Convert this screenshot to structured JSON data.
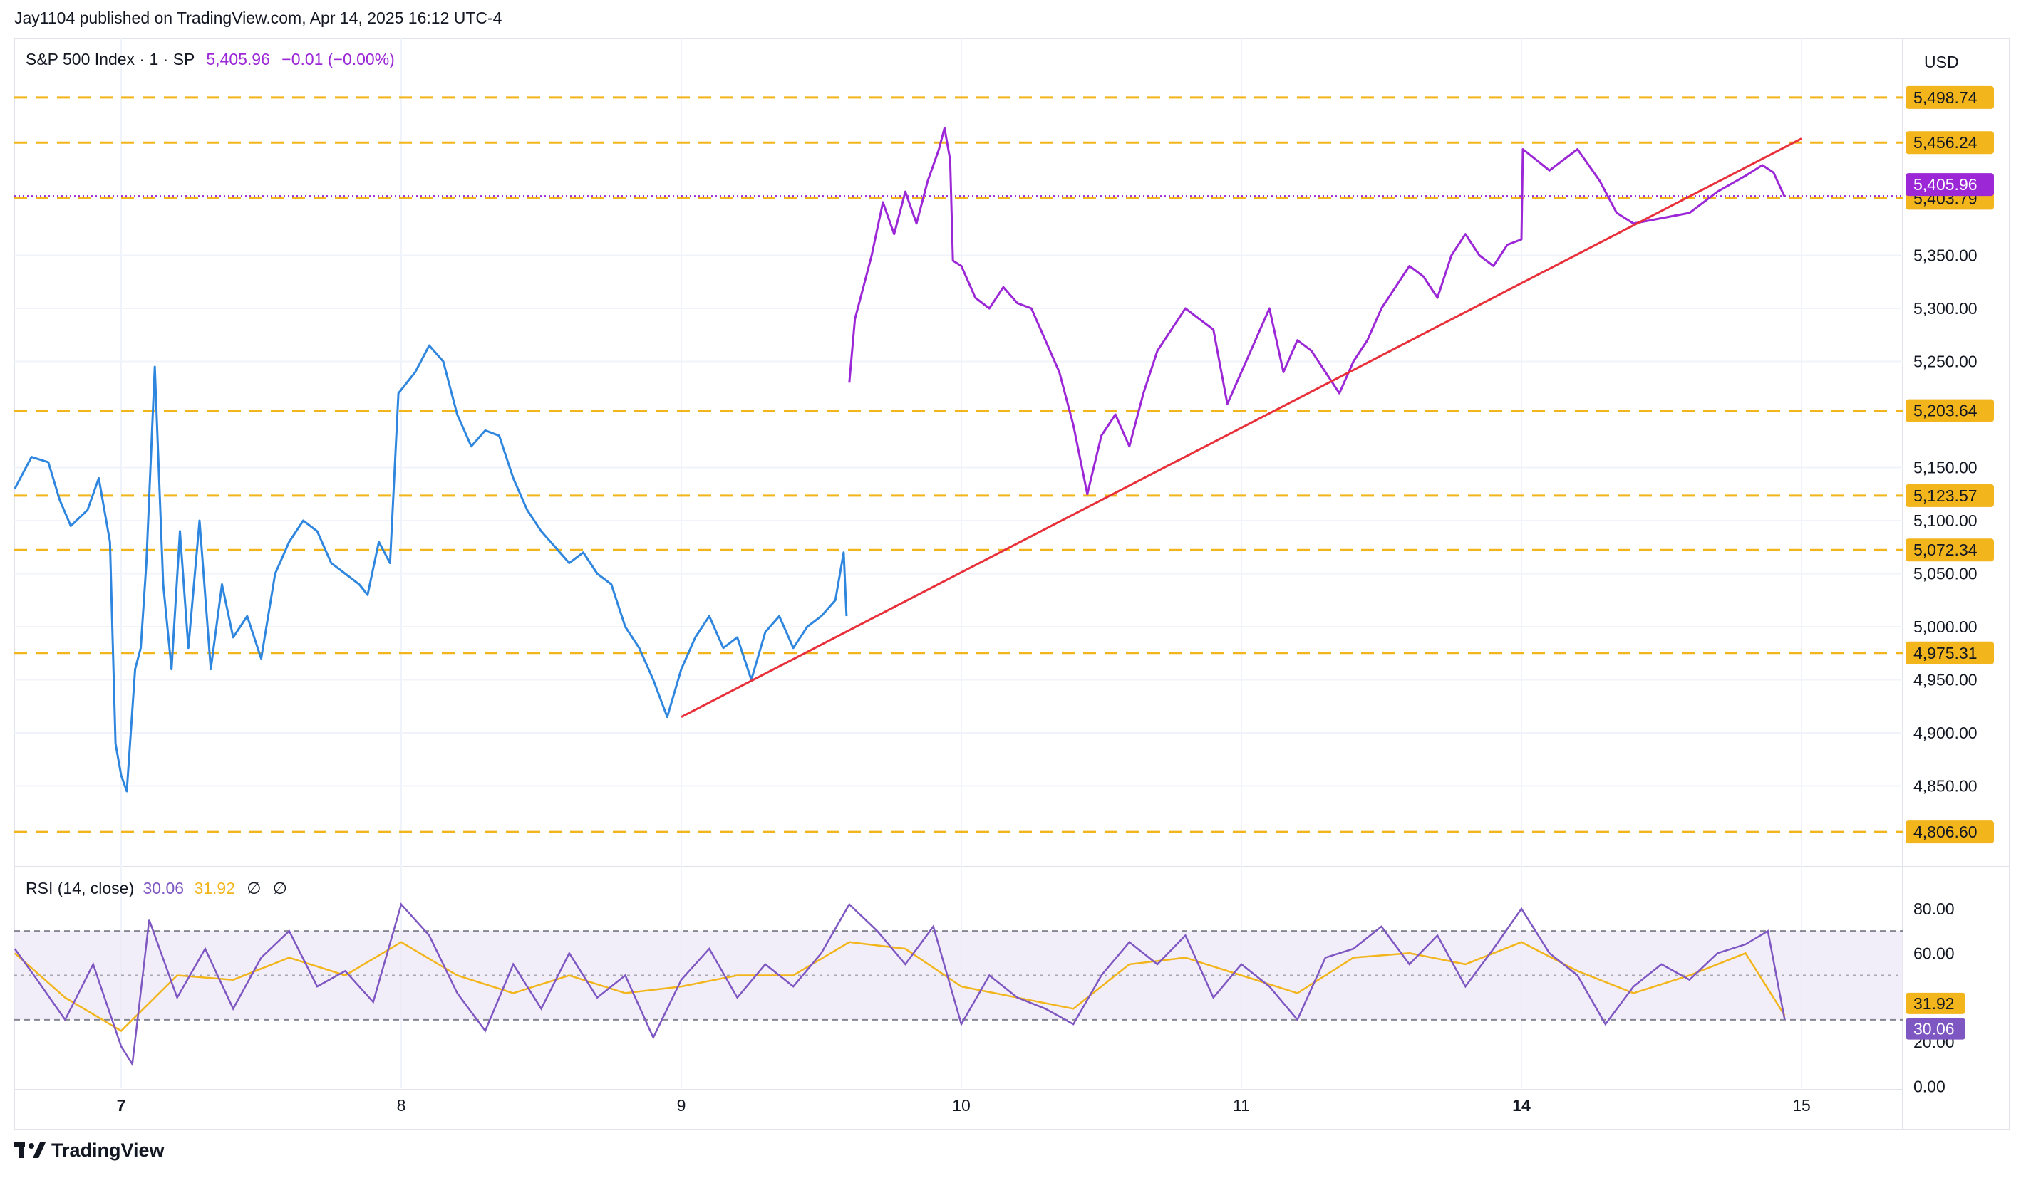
{
  "header": {
    "publisher": "Jay1104 published on TradingView.com, Apr 14, 2025 16:12 UTC-4"
  },
  "legend": {
    "symbol": "S&P 500 Index · 1 · SP",
    "price": "5,405.96",
    "change": "−0.01 (−0.00%)"
  },
  "rsi_legend": {
    "label": "RSI (14, close)",
    "rsi_value": "30.06",
    "ma_value": "31.92",
    "na1": "∅",
    "na2": "∅"
  },
  "currency": "USD",
  "brand": {
    "name": "TradingView",
    "icon": "tradingview-logo-icon"
  },
  "colors": {
    "price_early": "#2e86de",
    "price_late": "#9b27d6",
    "trendline": "#e8303a",
    "level": "#f2b51c",
    "rsi": "#7e57c2",
    "rsi_ma": "#f2b51c",
    "rsi_band": "#ede7f6"
  },
  "chart_data": [
    {
      "type": "line",
      "title": "S&P 500 Index · 1 · SP",
      "x_ticks": [
        "7",
        "8",
        "9",
        "10",
        "11",
        "14",
        "15"
      ],
      "y_ticks": [
        "4,850.00",
        "4,900.00",
        "4,950.00",
        "5,000.00",
        "5,050.00",
        "5,100.00",
        "5,150.00",
        "5,250.00",
        "5,300.00",
        "5,350.00"
      ],
      "ylim": [
        4790,
        5520
      ],
      "grid": true,
      "last_price": {
        "label": "5,405.96",
        "value": 5405.96
      },
      "horizontal_levels": [
        {
          "label": "5,498.74",
          "value": 5498.74
        },
        {
          "label": "5,456.24",
          "value": 5456.24
        },
        {
          "label": "5,403.79",
          "value": 5403.79
        },
        {
          "label": "5,203.64",
          "value": 5203.64
        },
        {
          "label": "5,123.57",
          "value": 5123.57
        },
        {
          "label": "5,072.34",
          "value": 5072.34
        },
        {
          "label": "4,975.31",
          "value": 4975.31
        },
        {
          "label": "4,806.60",
          "value": 4806.6
        }
      ],
      "trendline": {
        "from": {
          "day": 9,
          "value": 4915
        },
        "to": {
          "day": 15,
          "value": 5460
        }
      },
      "series": [
        {
          "points": [
            [
              6.62,
              5130
            ],
            [
              6.68,
              5160
            ],
            [
              6.74,
              5155
            ],
            [
              6.78,
              5120
            ],
            [
              6.82,
              5095
            ],
            [
              6.88,
              5110
            ],
            [
              6.92,
              5140
            ],
            [
              6.96,
              5080
            ],
            [
              6.98,
              4890
            ],
            [
              7.0,
              4860
            ],
            [
              7.02,
              4845
            ],
            [
              7.05,
              4960
            ],
            [
              7.07,
              4980
            ],
            [
              7.09,
              5060
            ],
            [
              7.12,
              5245
            ],
            [
              7.15,
              5040
            ],
            [
              7.18,
              4960
            ],
            [
              7.21,
              5090
            ],
            [
              7.24,
              4980
            ],
            [
              7.28,
              5100
            ],
            [
              7.32,
              4960
            ],
            [
              7.36,
              5040
            ],
            [
              7.4,
              4990
            ],
            [
              7.45,
              5010
            ],
            [
              7.5,
              4970
            ],
            [
              7.55,
              5050
            ],
            [
              7.6,
              5080
            ],
            [
              7.65,
              5100
            ],
            [
              7.7,
              5090
            ],
            [
              7.75,
              5060
            ],
            [
              7.8,
              5050
            ],
            [
              7.85,
              5040
            ],
            [
              7.88,
              5030
            ],
            [
              7.92,
              5080
            ],
            [
              7.96,
              5060
            ],
            [
              7.99,
              5220
            ],
            [
              8.05,
              5240
            ],
            [
              8.1,
              5265
            ],
            [
              8.15,
              5250
            ],
            [
              8.2,
              5200
            ],
            [
              8.25,
              5170
            ],
            [
              8.3,
              5185
            ],
            [
              8.35,
              5180
            ],
            [
              8.4,
              5140
            ],
            [
              8.45,
              5110
            ],
            [
              8.5,
              5090
            ],
            [
              8.55,
              5075
            ],
            [
              8.6,
              5060
            ],
            [
              8.65,
              5070
            ],
            [
              8.7,
              5050
            ],
            [
              8.75,
              5040
            ],
            [
              8.8,
              5000
            ],
            [
              8.85,
              4980
            ],
            [
              8.9,
              4950
            ],
            [
              8.95,
              4915
            ],
            [
              9.0,
              4960
            ],
            [
              9.05,
              4990
            ],
            [
              9.1,
              5010
            ],
            [
              9.15,
              4980
            ],
            [
              9.2,
              4990
            ],
            [
              9.25,
              4950
            ],
            [
              9.3,
              4995
            ],
            [
              9.35,
              5010
            ],
            [
              9.4,
              4980
            ],
            [
              9.45,
              5000
            ],
            [
              9.5,
              5010
            ],
            [
              9.55,
              5025
            ],
            [
              9.58,
              5070
            ],
            [
              9.59,
              5010
            ]
          ]
        },
        {
          "points": [
            [
              9.6,
              5230
            ],
            [
              9.62,
              5290
            ],
            [
              9.65,
              5320
            ],
            [
              9.68,
              5350
            ],
            [
              9.72,
              5400
            ],
            [
              9.76,
              5370
            ],
            [
              9.8,
              5410
            ],
            [
              9.84,
              5380
            ],
            [
              9.88,
              5420
            ],
            [
              9.92,
              5450
            ],
            [
              9.94,
              5470
            ],
            [
              9.96,
              5440
            ],
            [
              9.97,
              5345
            ],
            [
              10.0,
              5340
            ],
            [
              10.05,
              5310
            ],
            [
              10.1,
              5300
            ],
            [
              10.15,
              5320
            ],
            [
              10.2,
              5305
            ],
            [
              10.25,
              5300
            ],
            [
              10.3,
              5270
            ],
            [
              10.35,
              5240
            ],
            [
              10.4,
              5190
            ],
            [
              10.45,
              5125
            ],
            [
              10.5,
              5180
            ],
            [
              10.55,
              5200
            ],
            [
              10.6,
              5170
            ],
            [
              10.65,
              5220
            ],
            [
              10.7,
              5260
            ],
            [
              10.75,
              5280
            ],
            [
              10.8,
              5300
            ],
            [
              10.85,
              5290
            ],
            [
              10.9,
              5280
            ],
            [
              10.95,
              5210
            ],
            [
              11.0,
              5240
            ],
            [
              11.05,
              5270
            ],
            [
              11.1,
              5300
            ],
            [
              11.15,
              5240
            ],
            [
              11.2,
              5270
            ],
            [
              11.25,
              5260
            ],
            [
              11.3,
              5240
            ],
            [
              11.35,
              5220
            ],
            [
              11.4,
              5250
            ],
            [
              11.45,
              5270
            ],
            [
              11.5,
              5300
            ],
            [
              11.55,
              5320
            ],
            [
              11.6,
              5340
            ],
            [
              11.65,
              5330
            ],
            [
              11.7,
              5310
            ],
            [
              11.75,
              5350
            ],
            [
              11.8,
              5370
            ],
            [
              11.85,
              5350
            ],
            [
              11.9,
              5340
            ],
            [
              11.95,
              5360
            ],
            [
              12.0,
              5365
            ],
            [
              12.005,
              5450
            ],
            [
              12.1,
              5430
            ],
            [
              12.2,
              5450
            ],
            [
              12.28,
              5420
            ],
            [
              12.34,
              5390
            ],
            [
              12.4,
              5380
            ],
            [
              12.5,
              5385
            ],
            [
              12.6,
              5390
            ],
            [
              12.7,
              5410
            ],
            [
              12.8,
              5425
            ],
            [
              12.86,
              5435
            ],
            [
              12.9,
              5428
            ],
            [
              12.94,
              5405
            ]
          ]
        }
      ]
    },
    {
      "type": "line",
      "title": "RSI (14, close)",
      "y_ticks": [
        "0.00",
        "20.00",
        "60.00",
        "80.00"
      ],
      "ylim": [
        0,
        86
      ],
      "bands": [
        70,
        50,
        30
      ],
      "last_values": {
        "rsi": 30.06,
        "ma": 31.92,
        "rsi_label": "30.06",
        "ma_label": "31.92"
      },
      "series": [
        {
          "name": "RSI",
          "points": [
            [
              6.62,
              62
            ],
            [
              6.7,
              48
            ],
            [
              6.8,
              30
            ],
            [
              6.9,
              55
            ],
            [
              7.0,
              18
            ],
            [
              7.04,
              10
            ],
            [
              7.1,
              75
            ],
            [
              7.2,
              40
            ],
            [
              7.3,
              62
            ],
            [
              7.4,
              35
            ],
            [
              7.5,
              58
            ],
            [
              7.6,
              70
            ],
            [
              7.7,
              45
            ],
            [
              7.8,
              52
            ],
            [
              7.9,
              38
            ],
            [
              8.0,
              82
            ],
            [
              8.1,
              68
            ],
            [
              8.2,
              42
            ],
            [
              8.3,
              25
            ],
            [
              8.4,
              55
            ],
            [
              8.5,
              35
            ],
            [
              8.6,
              60
            ],
            [
              8.7,
              40
            ],
            [
              8.8,
              50
            ],
            [
              8.9,
              22
            ],
            [
              9.0,
              48
            ],
            [
              9.1,
              62
            ],
            [
              9.2,
              40
            ],
            [
              9.3,
              55
            ],
            [
              9.4,
              45
            ],
            [
              9.5,
              60
            ],
            [
              9.6,
              82
            ],
            [
              9.7,
              70
            ],
            [
              9.8,
              55
            ],
            [
              9.9,
              72
            ],
            [
              10.0,
              28
            ],
            [
              10.1,
              50
            ],
            [
              10.2,
              40
            ],
            [
              10.3,
              35
            ],
            [
              10.4,
              28
            ],
            [
              10.5,
              50
            ],
            [
              10.6,
              65
            ],
            [
              10.7,
              55
            ],
            [
              10.8,
              68
            ],
            [
              10.9,
              40
            ],
            [
              11.0,
              55
            ],
            [
              11.1,
              45
            ],
            [
              11.2,
              30
            ],
            [
              11.3,
              58
            ],
            [
              11.4,
              62
            ],
            [
              11.5,
              72
            ],
            [
              11.6,
              55
            ],
            [
              11.7,
              68
            ],
            [
              11.8,
              45
            ],
            [
              11.9,
              62
            ],
            [
              12.0,
              80
            ],
            [
              12.1,
              60
            ],
            [
              12.2,
              50
            ],
            [
              12.3,
              28
            ],
            [
              12.4,
              45
            ],
            [
              12.5,
              55
            ],
            [
              12.6,
              48
            ],
            [
              12.7,
              60
            ],
            [
              12.8,
              64
            ],
            [
              12.88,
              70
            ],
            [
              12.94,
              30
            ]
          ]
        },
        {
          "name": "MA",
          "points": [
            [
              6.62,
              60
            ],
            [
              6.8,
              40
            ],
            [
              7.0,
              25
            ],
            [
              7.2,
              50
            ],
            [
              7.4,
              48
            ],
            [
              7.6,
              58
            ],
            [
              7.8,
              50
            ],
            [
              8.0,
              65
            ],
            [
              8.2,
              50
            ],
            [
              8.4,
              42
            ],
            [
              8.6,
              50
            ],
            [
              8.8,
              42
            ],
            [
              9.0,
              45
            ],
            [
              9.2,
              50
            ],
            [
              9.4,
              50
            ],
            [
              9.6,
              65
            ],
            [
              9.8,
              62
            ],
            [
              10.0,
              45
            ],
            [
              10.2,
              40
            ],
            [
              10.4,
              35
            ],
            [
              10.6,
              55
            ],
            [
              10.8,
              58
            ],
            [
              11.0,
              50
            ],
            [
              11.2,
              42
            ],
            [
              11.4,
              58
            ],
            [
              11.6,
              60
            ],
            [
              11.8,
              55
            ],
            [
              12.0,
              65
            ],
            [
              12.2,
              52
            ],
            [
              12.4,
              42
            ],
            [
              12.6,
              50
            ],
            [
              12.8,
              60
            ],
            [
              12.94,
              31.92
            ]
          ]
        }
      ]
    }
  ]
}
